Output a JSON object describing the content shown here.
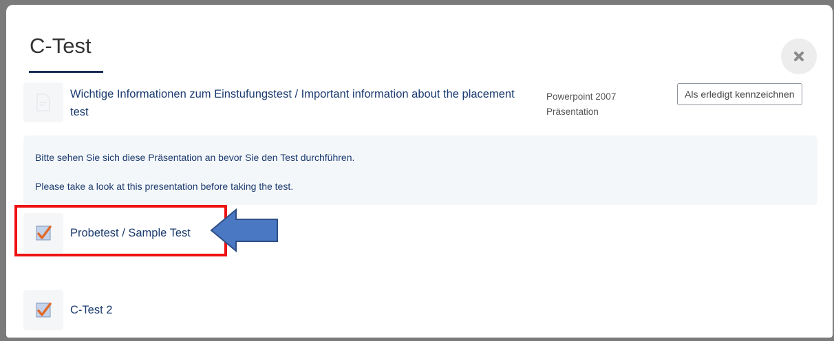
{
  "modal": {
    "title": "C-Test",
    "close_icon": "close-icon"
  },
  "activities": {
    "info": {
      "icon": "document-icon",
      "link": "Wichtige Informationen zum Einstufungstest / Important information about the placement test",
      "file_type_line1": "Powerpoint 2007",
      "file_type_line2": "Präsentation",
      "mark_done_label": "Als erledigt kennzeichnen"
    },
    "description": {
      "line1": "Bitte sehen Sie sich diese Präsentation an bevor Sie den Test durchführen.",
      "line2": "Please take a look at this presentation before taking the test."
    },
    "sample_test": {
      "icon": "quiz-checkmark-icon",
      "link": "Probetest / Sample Test"
    },
    "c_test_2": {
      "icon": "quiz-checkmark-icon",
      "link": "C-Test 2"
    }
  },
  "annotations": {
    "highlight_color": "#ee1111",
    "arrow_color": "#4a78c2",
    "arrow_icon": "left-arrow-icon"
  },
  "colors": {
    "link": "#1a3a6e",
    "title_underline": "#1b2a56",
    "backdrop": "#7b7b7b"
  }
}
